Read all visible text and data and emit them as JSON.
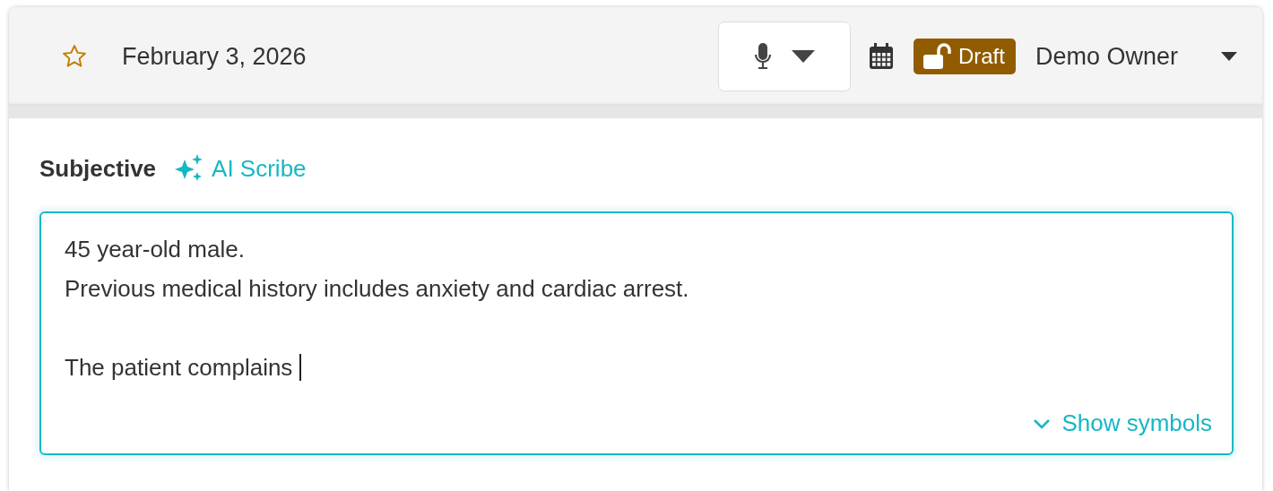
{
  "header": {
    "starred": false,
    "date": "February 3, 2026",
    "status": {
      "label": "Draft",
      "locked": false
    },
    "owner": "Demo Owner"
  },
  "section": {
    "title": "Subjective",
    "ai_link": "AI Scribe"
  },
  "note": {
    "value": "45 year-old male.\nPrevious medical history includes anxiety and cardiac arrest.\n\nThe patient complains ",
    "focused": true,
    "symbols_toggle": "Show symbols"
  }
}
